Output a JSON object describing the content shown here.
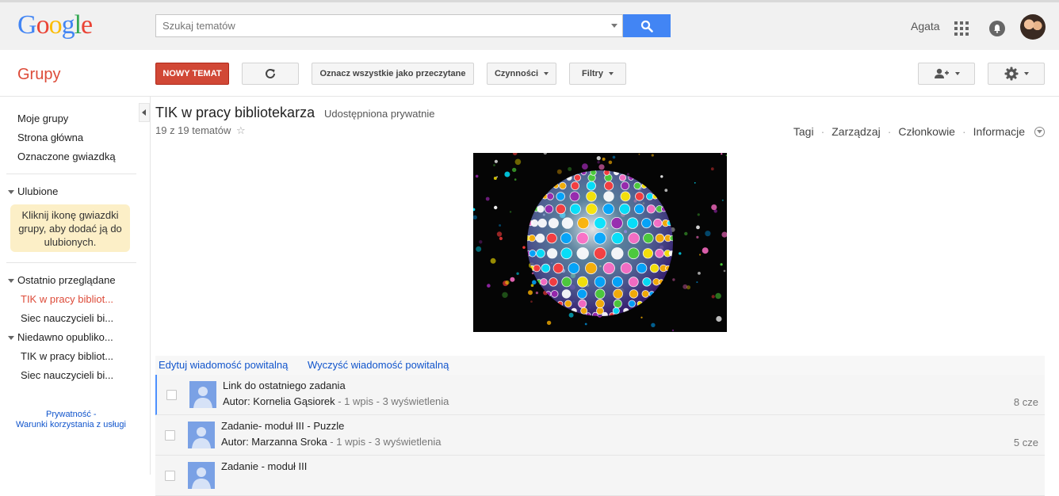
{
  "header": {
    "logo_letters": [
      {
        "ch": "G",
        "color": "#4285f4"
      },
      {
        "ch": "o",
        "color": "#ea4335"
      },
      {
        "ch": "o",
        "color": "#fbbc05"
      },
      {
        "ch": "g",
        "color": "#4285f4"
      },
      {
        "ch": "l",
        "color": "#34a853"
      },
      {
        "ch": "e",
        "color": "#ea4335"
      }
    ],
    "search_placeholder": "Szukaj tematów",
    "user_name": "Agata"
  },
  "toolbar": {
    "section_title": "Grupy",
    "new_topic": "NOWY TEMAT",
    "mark_all_read": "Oznacz wszystkie jako przeczytane",
    "actions": "Czynności",
    "filters": "Filtry"
  },
  "sidebar": {
    "my_groups": "Moje grupy",
    "home": "Strona główna",
    "starred": "Oznaczone gwiazdką",
    "favorites_header": "Ulubione",
    "favorites_hint": "Kliknij ikonę gwiazdki grupy, aby dodać ją do ulubionych.",
    "recent_header": "Ostatnio przeglądane",
    "recent_items": [
      "TIK w pracy bibliot...",
      "Siec nauczycieli bi..."
    ],
    "published_header": "Niedawno opubliko...",
    "published_items": [
      "TIK w pracy bibliot...",
      "Siec nauczycieli bi..."
    ],
    "privacy": "Prywatność -",
    "terms": "Warunki korzystania z usługi"
  },
  "group": {
    "title": "TIK w pracy bibliotekarza",
    "visibility": "Udostępniona prywatnie",
    "topic_count": "19 z 19 tematów",
    "nav": [
      "Tagi",
      "Zarządzaj",
      "Członkowie",
      "Informacje"
    ],
    "edit_welcome": "Edytuj wiadomość powitalną",
    "clear_welcome": "Wyczyść wiadomość powitalną"
  },
  "topics": [
    {
      "title": "Link do ostatniego zadania",
      "author": "Autor: Kornelia Gąsiorek",
      "stats": " - 1 wpis - 3 wyświetlenia",
      "date": "8 cze"
    },
    {
      "title": "Zadanie- moduł III - Puzzle",
      "author": "Autor: Marzanna Sroka",
      "stats": " - 1 wpis - 3 wyświetlenia",
      "date": "5 cze"
    },
    {
      "title": "Zadanie - moduł III",
      "author": "",
      "stats": "",
      "date": ""
    }
  ],
  "colors": {
    "accent_red": "#dd4b39",
    "button_red": "#d14836",
    "search_blue": "#4285f4",
    "link_blue": "#1155cc",
    "selection_blue": "#4d90fe"
  }
}
